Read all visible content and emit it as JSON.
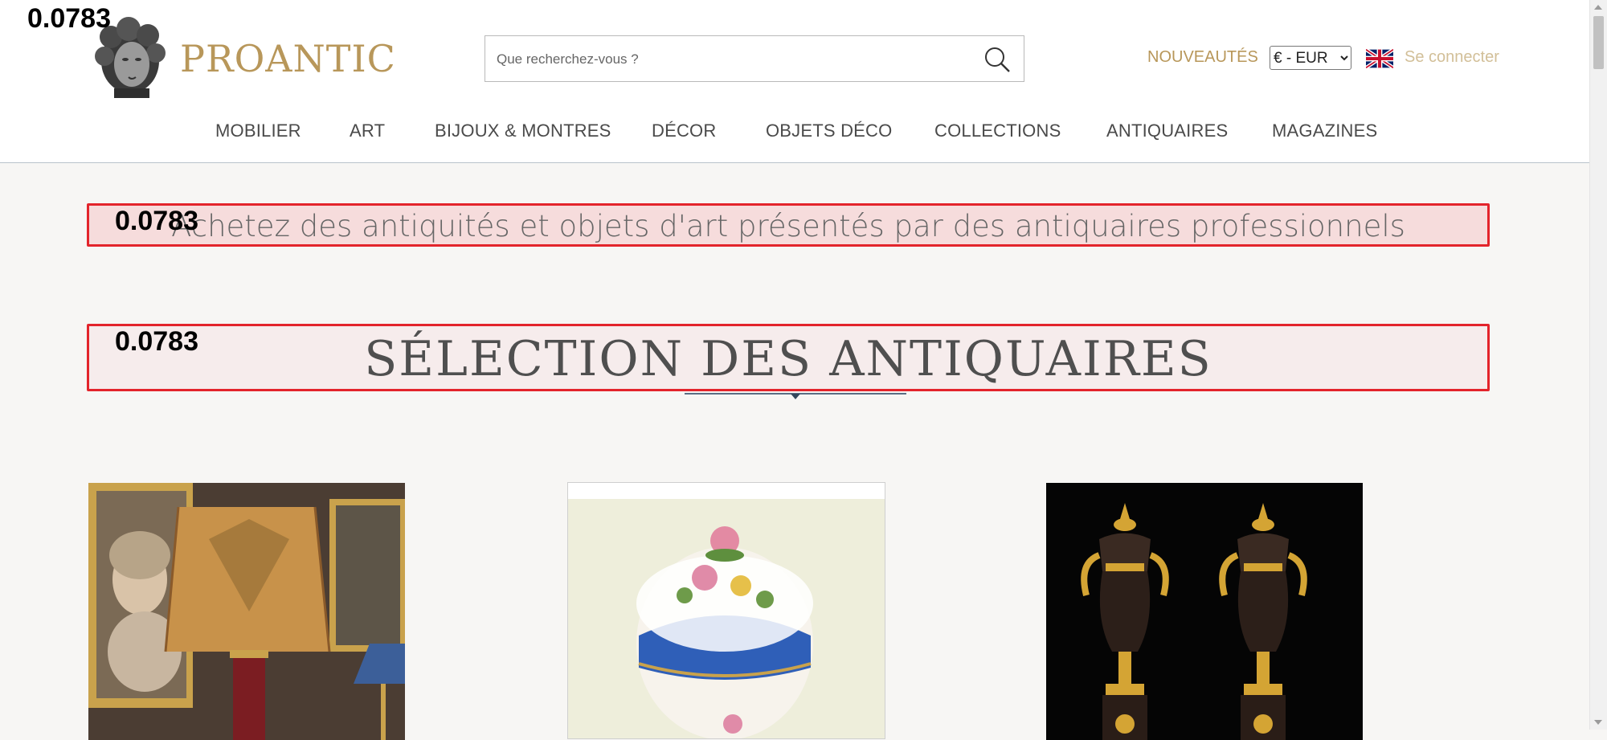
{
  "brand": {
    "name": "PROANTIC"
  },
  "search": {
    "placeholder": "Que recherchez-vous ?"
  },
  "header": {
    "nouveautes": "NOUVEAUTÉS",
    "currency": "€ - EUR",
    "login": "Se connecter"
  },
  "nav": [
    "MOBILIER",
    "ART",
    "BIJOUX & MONTRES",
    "DÉCOR",
    "OBJETS DÉCO",
    "COLLECTIONS",
    "ANTIQUAIRES",
    "MAGAZINES"
  ],
  "tagline": "Achetez des antiquités et objets d'art présentés par des antiquaires professionnels",
  "section_title": "SÉLECTION DES ANTIQUAIRES",
  "scores": [
    "0.0783",
    "0.0783",
    "0.0783"
  ],
  "products": [
    {
      "icon": "lamp-and-portraits-photo"
    },
    {
      "icon": "porcelain-egg-box-photo"
    },
    {
      "icon": "bronze-vases-photo"
    }
  ],
  "colors": {
    "brand_gold": "#b8975a",
    "highlight_red": "#e3242b",
    "background": "#f7f6f4"
  }
}
